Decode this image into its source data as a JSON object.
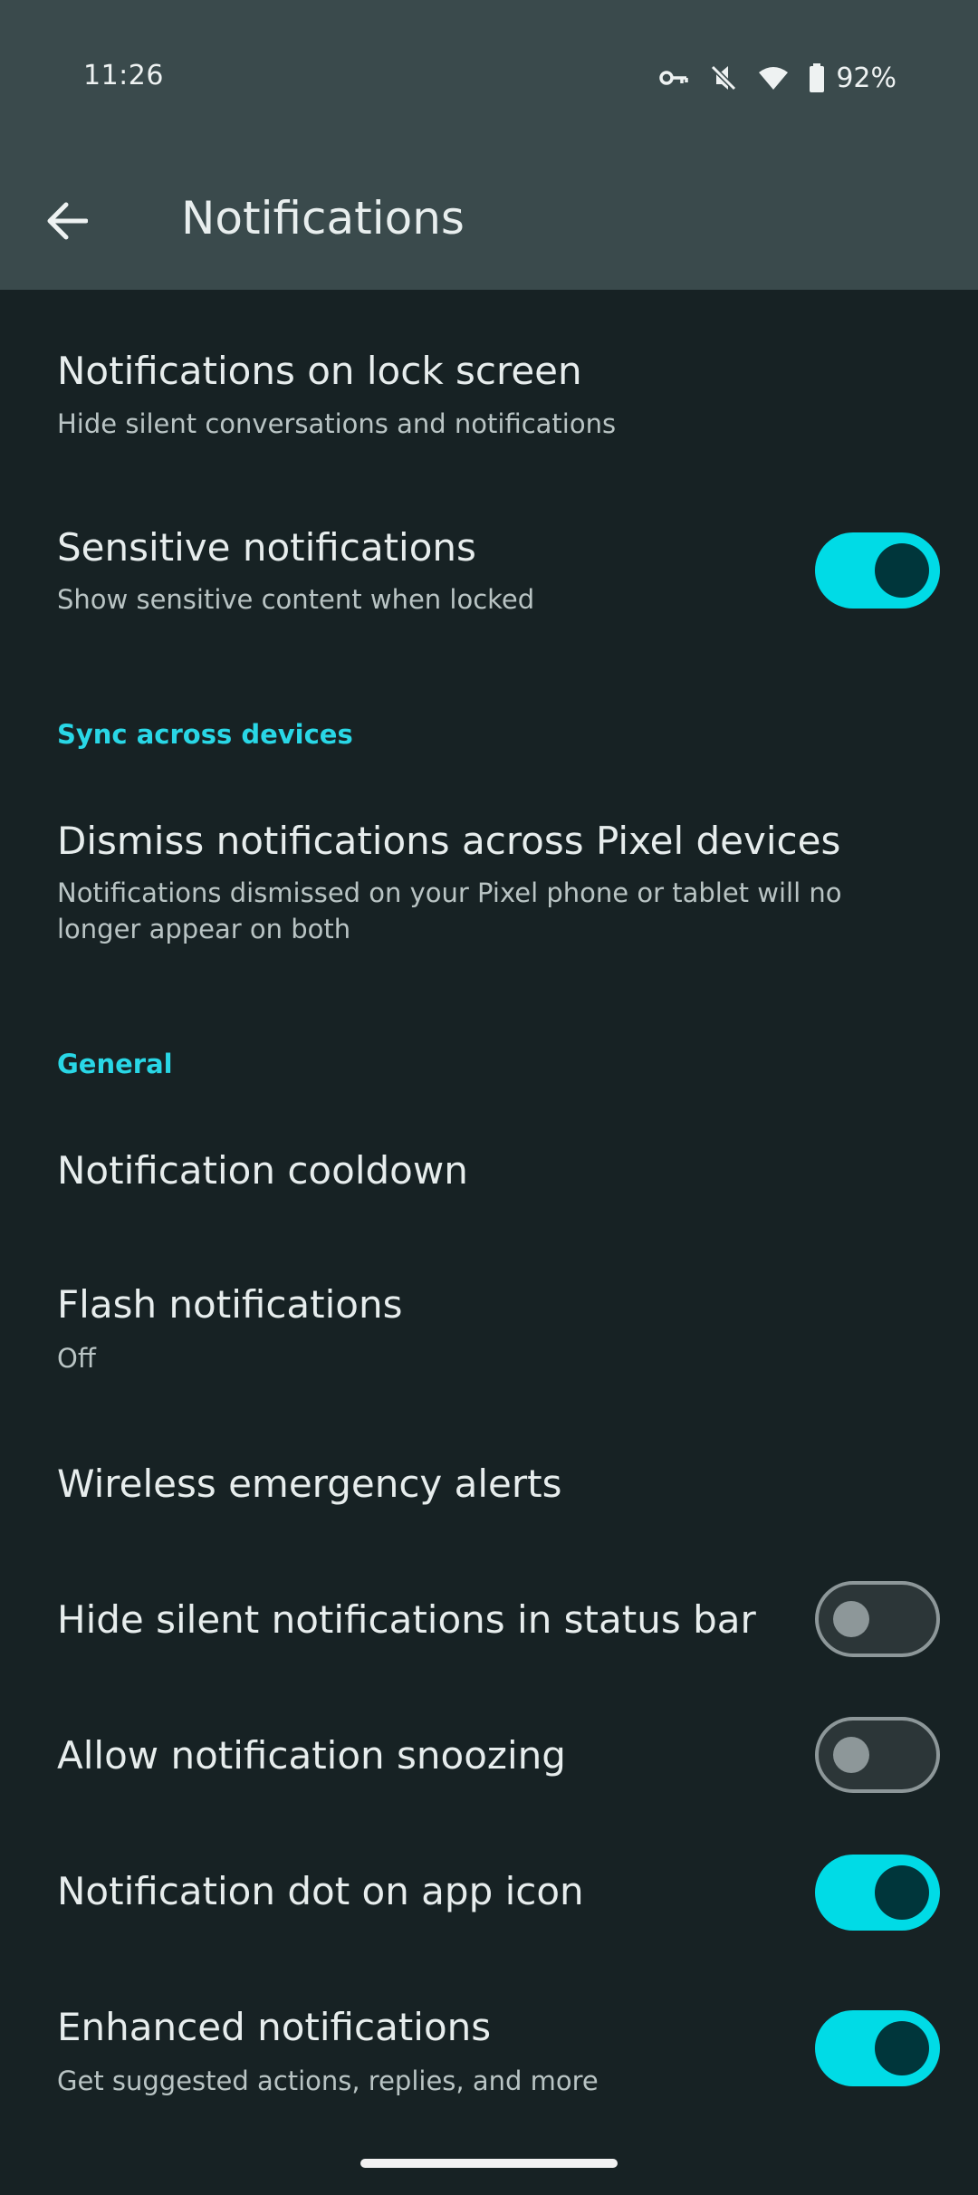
{
  "status_bar": {
    "time": "11:26",
    "battery": "92%",
    "icons": [
      "vpn-key-icon",
      "vibrate-off-icon",
      "wifi-icon",
      "battery-icon"
    ]
  },
  "app_bar": {
    "title": "Notifications",
    "back_icon": "arrow-back-icon"
  },
  "colors": {
    "accent": "#00dbe6",
    "header_bg": "#3a4a4c",
    "page_bg": "#172224",
    "section_header": "#29d7e6"
  },
  "items": [
    {
      "title": "Notifications on lock screen",
      "summary": "Hide silent conversations and notifications"
    },
    {
      "title": "Sensitive notifications",
      "summary": "Show sensitive content when locked",
      "toggle": true
    }
  ],
  "sections": {
    "sync": {
      "header": "Sync across devices",
      "items": [
        {
          "title": "Dismiss notifications across Pixel devices",
          "summary": "Notifications dismissed on your Pixel phone or tablet will no longer appear on both"
        }
      ]
    },
    "general": {
      "header": "General",
      "items": [
        {
          "title": "Notification cooldown"
        },
        {
          "title": "Flash notifications",
          "summary": "Off"
        },
        {
          "title": "Wireless emergency alerts"
        },
        {
          "title": "Hide silent notifications in status bar",
          "toggle": false
        },
        {
          "title": "Allow notification snoozing",
          "toggle": false
        },
        {
          "title": "Notification dot on app icon",
          "toggle": true
        },
        {
          "title": "Enhanced notifications",
          "summary": "Get suggested actions, replies, and more",
          "toggle": true
        }
      ]
    }
  }
}
